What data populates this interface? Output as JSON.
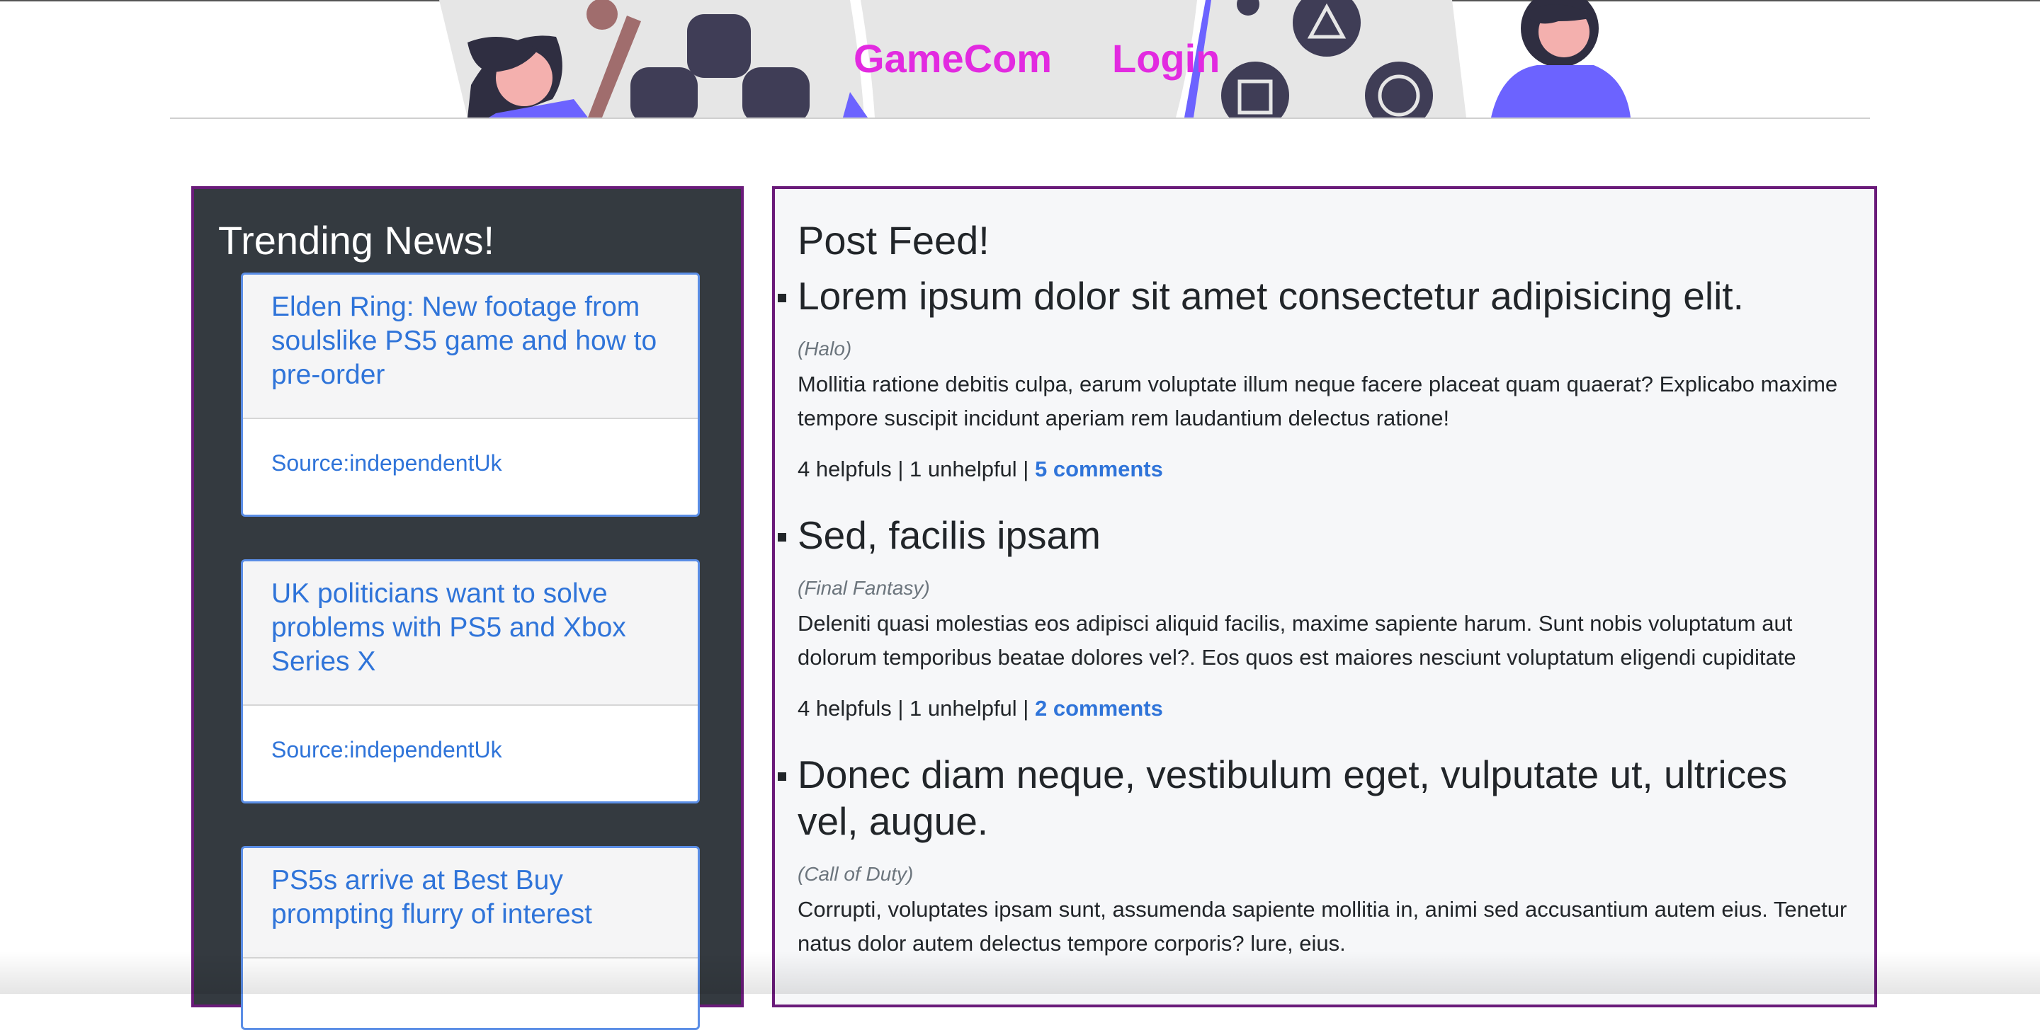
{
  "header": {
    "brand": "GameCom",
    "login": "Login"
  },
  "trending": {
    "title": "Trending News!",
    "items": [
      {
        "title": "Elden Ring: New footage from soulslike PS5 game and how to pre-order",
        "source": "Source:independentUk"
      },
      {
        "title": "UK politicians want to solve problems with PS5 and Xbox Series X",
        "source": "Source:independentUk"
      },
      {
        "title": "PS5s arrive at Best Buy prompting flurry of interest",
        "source": ""
      }
    ]
  },
  "feed": {
    "title": "Post Feed!",
    "posts": [
      {
        "title": "Lorem ipsum dolor sit amet consectetur adipisicing elit.",
        "game": "(Halo)",
        "body": "Mollitia ratione debitis culpa, earum voluptate illum neque facere placeat quam quaerat? Explicabo maxime tempore suscipit incidunt aperiam rem laudantium delectus ratione!",
        "helpfuls": "4 helpfuls",
        "unhelpful": "1 unhelpful",
        "comments": "5 comments"
      },
      {
        "title": "Sed, facilis ipsam",
        "game": "(Final Fantasy)",
        "body": "Deleniti quasi molestias eos adipisci aliquid facilis, maxime sapiente harum. Sunt nobis voluptatum aut dolorum temporibus beatae dolores vel?. Eos quos est maiores nesciunt voluptatum eligendi cupiditate",
        "helpfuls": "4 helpfuls",
        "unhelpful": "1 unhelpful",
        "comments": "2 comments"
      },
      {
        "title": "Donec diam neque, vestibulum eget, vulputate ut, ultrices vel, augue.",
        "game": "(Call of Duty)",
        "body": "Corrupti, voluptates ipsam sunt, assumenda sapiente mollitia in, animi sed accusantium autem eius. Tenetur natus dolor autem delectus tempore corporis? lure, eius.",
        "helpfuls": "",
        "unhelpful": "",
        "comments": ""
      }
    ]
  },
  "colors": {
    "brand": "#e22ae0",
    "link": "#2f74d9",
    "news_panel_bg": "#343a40",
    "panel_border": "#6a1b7a",
    "hero_accent": "#6c63ff"
  }
}
